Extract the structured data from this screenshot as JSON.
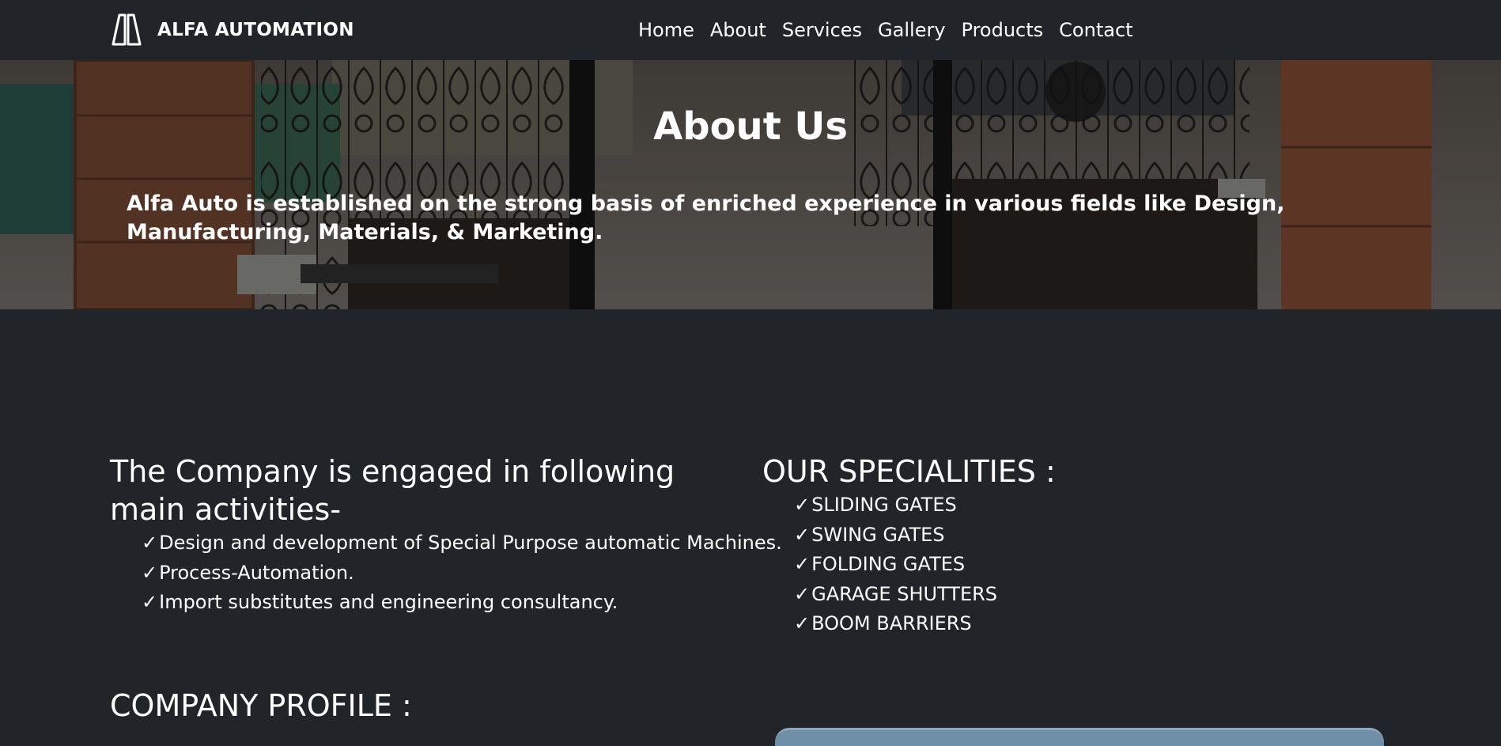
{
  "navbar": {
    "brand": "ALFA AUTOMATION",
    "links": [
      "Home",
      "About",
      "Services",
      "Gallery",
      "Products",
      "Contact"
    ]
  },
  "hero": {
    "title": "About Us",
    "text": "Alfa Auto is established on the strong basis of enriched experience in various fields like Design, Manufacturing, Materials, & Marketing."
  },
  "activities": {
    "heading": "The Company is engaged in following main activities-",
    "items": [
      "Design and development of Special Purpose automatic Machines.",
      "Process-Automation.",
      "Import substitutes and engineering consultancy."
    ]
  },
  "specialities": {
    "heading": "OUR SPECIALITIES :",
    "items": [
      "SLIDING GATES",
      "SWING GATES",
      "FOLDING GATES",
      "GARAGE SHUTTERS",
      "BOOM BARRIERS"
    ]
  },
  "profile": {
    "heading": "COMPANY PROFILE :"
  },
  "icons": {
    "check": "✓",
    "logo": "alfa-logo-icon"
  },
  "colors": {
    "background": "#212529",
    "text": "#ffffff"
  }
}
